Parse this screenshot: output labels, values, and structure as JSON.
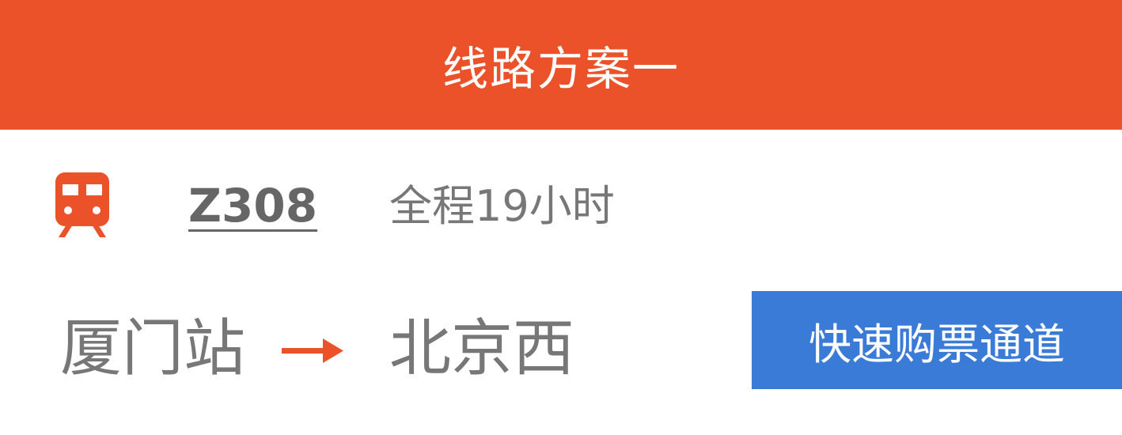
{
  "header": {
    "title": "线路方案一"
  },
  "train": {
    "icon": "train-icon",
    "number": "Z308",
    "duration": "全程19小时"
  },
  "route": {
    "from": "厦门站",
    "arrow_icon": "arrow-right-icon",
    "to": "北京西"
  },
  "actions": {
    "buy_label": "快速购票通道"
  },
  "colors": {
    "header_bg": "#eb5229",
    "accent_orange": "#eb5229",
    "button_blue": "#3a7bd8",
    "text_gray": "#777777"
  }
}
